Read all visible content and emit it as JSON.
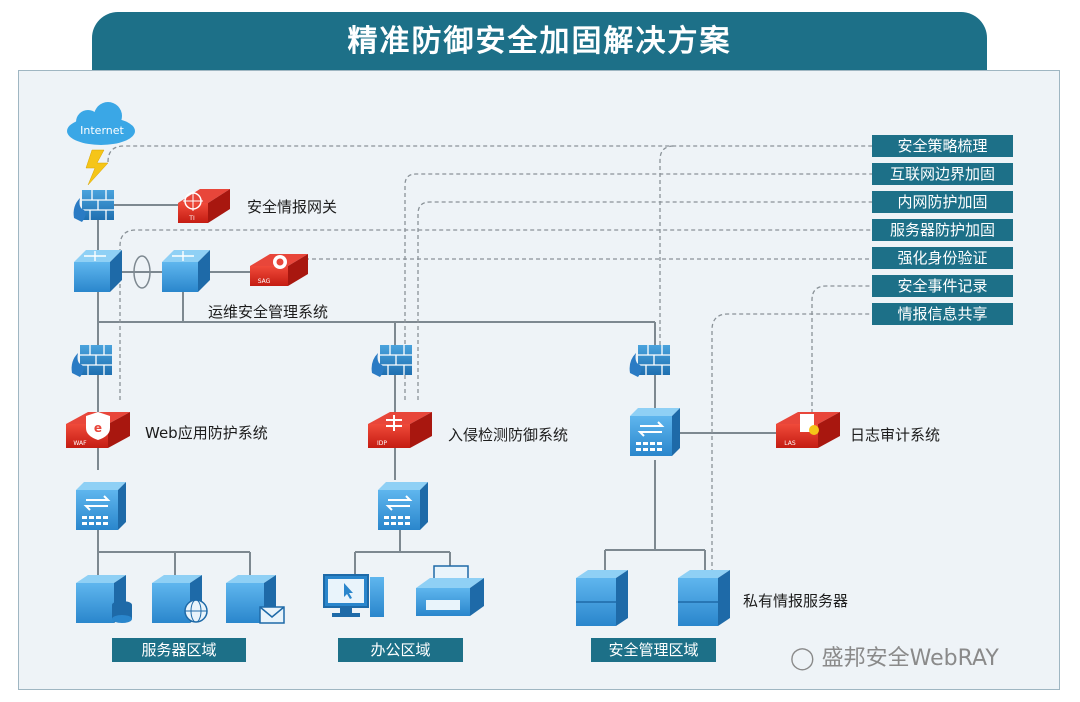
{
  "title": "精准防御安全加固解决方案",
  "cloud_label": "Internet",
  "labels": {
    "intel_gateway": "安全情报网关",
    "ops_mgmt": "运维安全管理系统",
    "waf": "Web应用防护系统",
    "ids": "入侵检测防御系统",
    "log_audit": "日志审计系统",
    "private_intel_server": "私有情报服务器"
  },
  "badges": {
    "ti": "TI",
    "sag": "SAG",
    "waf": "WAF",
    "idp": "IDP",
    "las": "LAS"
  },
  "tags": [
    "安全策略梳理",
    "互联网边界加固",
    "内网防护加固",
    "服务器防护加固",
    "强化身份验证",
    "安全事件记录",
    "情报信息共享"
  ],
  "zones": {
    "server": "服务器区域",
    "office": "办公区域",
    "security_mgmt": "安全管理区域"
  },
  "watermark": "盛邦安全WebRAY"
}
